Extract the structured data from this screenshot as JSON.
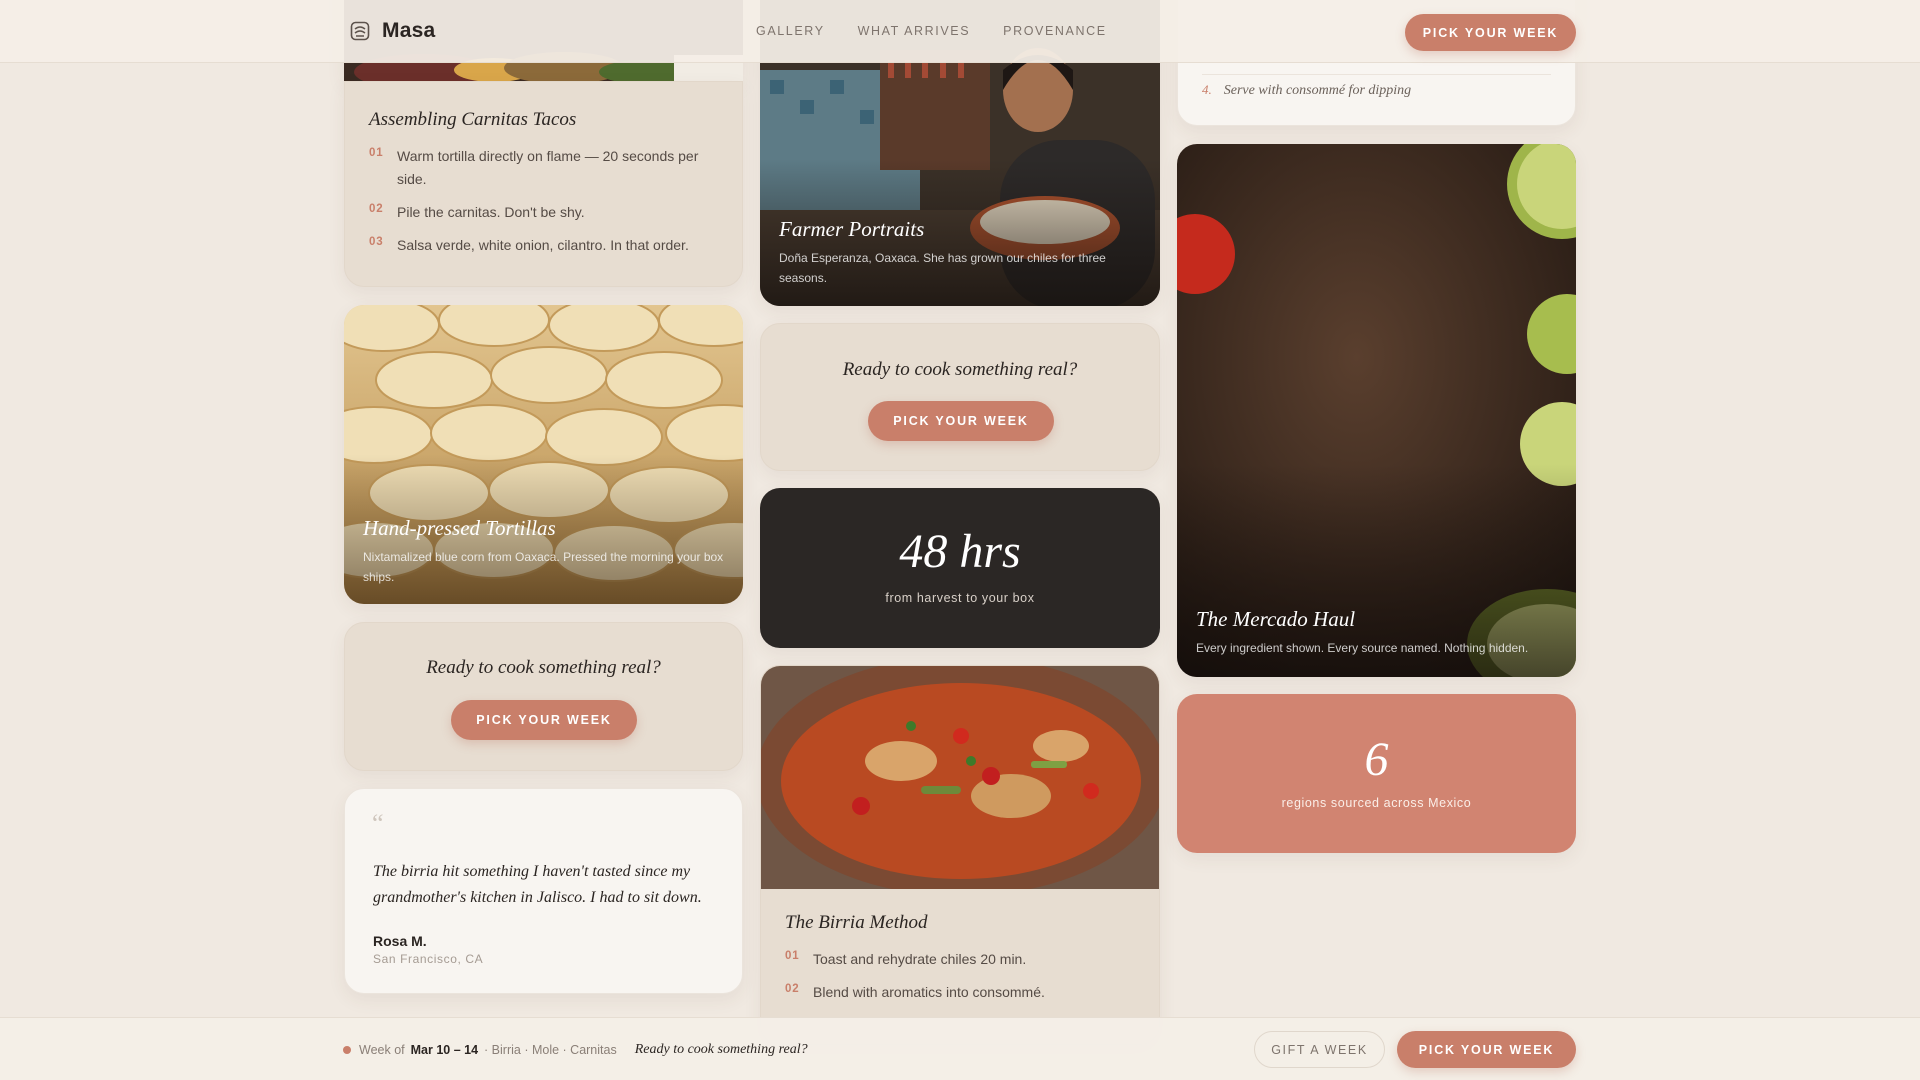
{
  "header": {
    "brand": "Masa",
    "nav": [
      "GALLERY",
      "WHAT ARRIVES",
      "PROVENANCE"
    ],
    "cta": "PICK YOUR WEEK"
  },
  "col1": {
    "carnitas": {
      "title": "Assembling Carnitas Tacos",
      "steps": [
        {
          "num": "01",
          "text": "Warm tortilla directly on flame — 20 seconds per side."
        },
        {
          "num": "02",
          "text": "Pile the carnitas. Don't be shy."
        },
        {
          "num": "03",
          "text": "Salsa verde, white onion, cilantro. In that order."
        }
      ]
    },
    "tortillas": {
      "title": "Hand-pressed Tortillas",
      "desc": "Nixtamalized blue corn from Oaxaca. Pressed the morning your box ships."
    },
    "cta": {
      "text": "Ready to cook something real?",
      "button": "PICK YOUR WEEK"
    },
    "testimonial": {
      "quote_mark": "“",
      "quote": "The birria hit something I haven't tasted since my grandmother's kitchen in Jalisco. I had to sit down.",
      "name": "Rosa M.",
      "location": "San Francisco, CA"
    }
  },
  "col2": {
    "farmer": {
      "title": "Farmer Portraits",
      "desc": "Doña Esperanza, Oaxaca. She has grown our chiles for three seasons."
    },
    "cta": {
      "text": "Ready to cook something real?",
      "button": "PICK YOUR WEEK"
    },
    "stat": {
      "value": "48 hrs",
      "label": "from harvest to your box"
    },
    "birria": {
      "title": "The Birria Method",
      "steps": [
        {
          "num": "01",
          "text": "Toast and rehydrate chiles 20 min."
        },
        {
          "num": "02",
          "text": "Blend with aromatics into consommé."
        }
      ]
    }
  },
  "col3": {
    "serve_step": {
      "num": "4.",
      "text": "Serve with consommé for dipping"
    },
    "mercado": {
      "title": "The Mercado Haul",
      "desc": "Every ingredient shown. Every source named. Nothing hidden."
    },
    "stat": {
      "value": "6",
      "label": "regions sourced across Mexico"
    }
  },
  "bottombar": {
    "week_prefix": "Week of",
    "week_dates": "Mar 10 – 14",
    "dishes": "· Birria · Mole · Carnitas",
    "cta_text": "Ready to cook something real?",
    "gift": "GIFT A WEEK",
    "pick": "PICK YOUR WEEK"
  },
  "colors": {
    "accent": "#c97f6a",
    "background": "#f0e9e1",
    "dark_card": "#2b2725",
    "terracotta_card": "#d18471"
  }
}
